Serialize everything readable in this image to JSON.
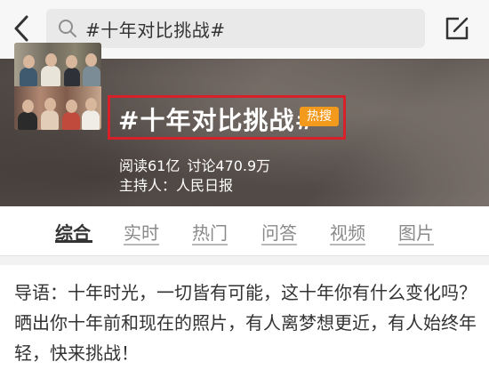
{
  "topbar": {
    "search_query": "#十年对比挑战#"
  },
  "topic": {
    "title": "#十年对比挑战#",
    "badge": "热搜",
    "reads": "阅读61亿",
    "discussions": "讨论470.9万",
    "host": "主持人：人民日报"
  },
  "tabs": [
    {
      "label": "综合"
    },
    {
      "label": "实时"
    },
    {
      "label": "热门"
    },
    {
      "label": "问答"
    },
    {
      "label": "视频"
    },
    {
      "label": "图片"
    }
  ],
  "intro": {
    "text": "导语：十年时光，一切皆有可能，这十年你有什么变化吗？晒出你十年前和现在的照片，有人离梦想更近，有人始终年轻，快来挑战！"
  },
  "colors": {
    "highlight_box": "#d8202a",
    "hot_badge": "#f39a1c"
  },
  "icons": [
    "back-arrow-icon",
    "search-icon",
    "compose-icon"
  ]
}
